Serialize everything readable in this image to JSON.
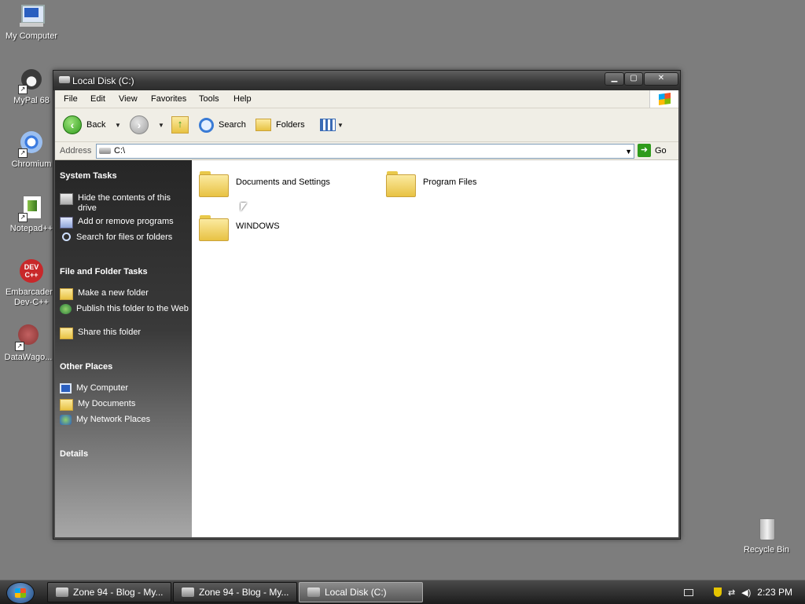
{
  "desktop": {
    "icons": [
      {
        "label": "My Computer"
      },
      {
        "label": "MyPal 68"
      },
      {
        "label": "Chromium"
      },
      {
        "label": "Notepad++"
      },
      {
        "label": "Embarcadero Dev-C++"
      },
      {
        "label": "DataWago..."
      },
      {
        "label": "Recycle Bin"
      }
    ],
    "devcpp_icon_text": "DEV\nC++"
  },
  "window": {
    "title": "Local Disk (C:)",
    "menu": [
      "File",
      "Edit",
      "View",
      "Favorites",
      "Tools",
      "Help"
    ],
    "toolbar": {
      "back_label": "Back",
      "search_label": "Search",
      "folders_label": "Folders"
    },
    "address": {
      "label": "Address",
      "value": "C:\\",
      "go_label": "Go"
    }
  },
  "taskpane": {
    "system_tasks": {
      "title": "System Tasks",
      "items": [
        "Hide the contents of this drive",
        "Add or remove programs",
        "Search for files or folders"
      ]
    },
    "file_folder_tasks": {
      "title": "File and Folder Tasks",
      "items": [
        "Make a new folder",
        "Publish this folder to the Web",
        "Share this folder"
      ]
    },
    "other_places": {
      "title": "Other Places",
      "items": [
        "My Computer",
        "My Documents",
        "My Network Places"
      ]
    },
    "details": {
      "title": "Details"
    }
  },
  "content": {
    "folders": [
      "Documents and Settings",
      "Program Files",
      "WINDOWS"
    ]
  },
  "taskbar": {
    "buttons": [
      "Zone 94 - Blog - My...",
      "Zone 94 - Blog - My...",
      "Local Disk (C:)"
    ],
    "clock": "2:23 PM"
  },
  "colors": {
    "desktop_bg": "#7d7d7d",
    "go_green": "#2f9b1b",
    "folder_yellow": "#e8c243"
  }
}
